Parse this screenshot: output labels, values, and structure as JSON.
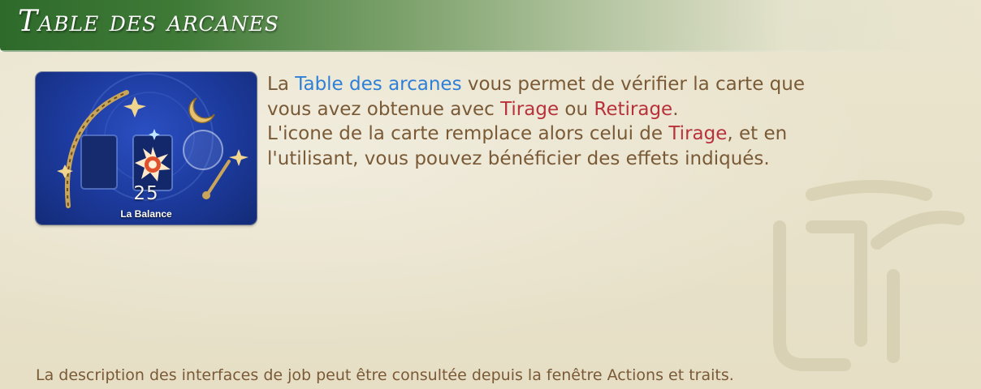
{
  "header": {
    "title": "Table des arcanes"
  },
  "card": {
    "number": "25",
    "name": "La Balance",
    "icon": "arcana-table-icon"
  },
  "description": {
    "line1": {
      "pre": "La ",
      "highlight": "Table des arcanes",
      "post": " vous permet de vérifier la carte que"
    },
    "line2": {
      "pre": "vous avez obtenue avec ",
      "hl1": "Tirage",
      "mid": " ou ",
      "hl2": "Retirage",
      "post": "."
    },
    "line3": {
      "pre": "L'icone de la carte remplace alors celui de ",
      "hl": "Tirage",
      "post": ", et en"
    },
    "line4": {
      "text": "l'utilisant, vous pouvez bénéficier des effets indiqués."
    }
  },
  "footer": {
    "text": "La description des interfaces de job peut être consultée depuis la fenêtre Actions et traits."
  },
  "colors": {
    "title_bar": "#3f7a37",
    "text": "#7a5a36",
    "highlight_blue": "#2f7fd6",
    "highlight_red": "#b8323c",
    "card_bg": "#1c3a9c"
  }
}
